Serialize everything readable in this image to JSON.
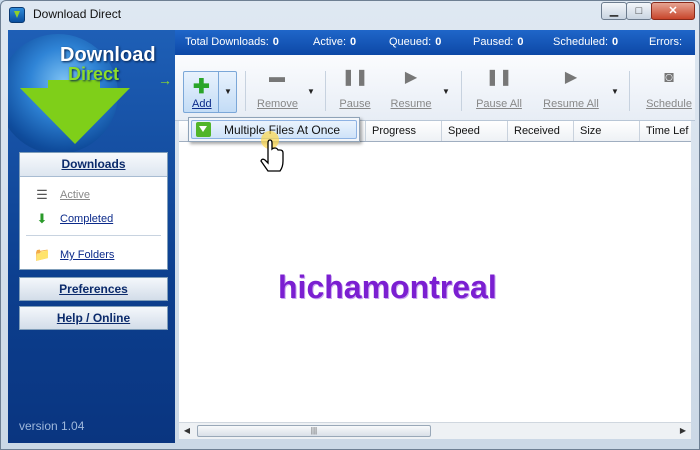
{
  "window": {
    "title": "Download Direct"
  },
  "stats": [
    {
      "label": "Total Downloads:",
      "value": "0"
    },
    {
      "label": "Active:",
      "value": "0"
    },
    {
      "label": "Queued:",
      "value": "0"
    },
    {
      "label": "Paused:",
      "value": "0"
    },
    {
      "label": "Scheduled:",
      "value": "0"
    },
    {
      "label": "Errors:",
      "value": ""
    }
  ],
  "sidebar": {
    "logo_line1": "Download",
    "logo_line2": "Direct",
    "downloads_header": "Downloads",
    "items": [
      {
        "label": "Active",
        "icon": "list-icon"
      },
      {
        "label": "Completed",
        "icon": "completed-icon"
      },
      {
        "label": "My Folders",
        "icon": "folder-icon"
      }
    ],
    "preferences": "Preferences",
    "help": "Help / Online",
    "version": "version 1.04"
  },
  "toolbar": {
    "add": "Add",
    "remove": "Remove",
    "pause": "Pause",
    "resume": "Resume",
    "pause_all": "Pause All",
    "resume_all": "Resume All",
    "schedule": "Schedule"
  },
  "dropdown": {
    "item": "Multiple Files At Once"
  },
  "grid": {
    "columns": [
      "Progress",
      "Speed",
      "Received",
      "Size",
      "Time Lef"
    ]
  },
  "watermark": "hichamontreal",
  "colors": {
    "accent": "#0d48a6",
    "watermark": "#7b1fd1",
    "arrow": "#7fcf19"
  }
}
